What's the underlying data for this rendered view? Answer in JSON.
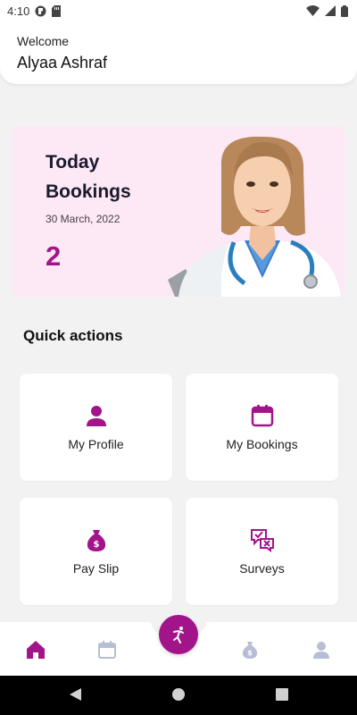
{
  "status_bar": {
    "time": "4:10",
    "icons": [
      "app-notification-icon",
      "sd-card-icon",
      "wifi-icon",
      "signal-icon",
      "battery-icon"
    ]
  },
  "header": {
    "welcome": "Welcome",
    "user_name": "Alyaa Ashraf"
  },
  "today_bookings": {
    "title": "Today Bookings",
    "date": "30 March, 2022",
    "count": "2",
    "image": "doctor-photo"
  },
  "quick_actions": {
    "title": "Quick actions",
    "items": [
      {
        "label": "My Profile",
        "icon": "person-icon"
      },
      {
        "label": "My Bookings",
        "icon": "calendar-icon"
      },
      {
        "label": "Pay Slip",
        "icon": "money-bag-icon"
      },
      {
        "label": "Surveys",
        "icon": "survey-icon"
      }
    ]
  },
  "bottom_nav": {
    "items": [
      "home-icon",
      "calendar-icon",
      "dancer-icon",
      "money-bag-icon",
      "person-icon"
    ],
    "active": "home-icon"
  },
  "colors": {
    "accent": "#a2158a",
    "card_bg": "#fde8f5",
    "inactive_nav": "#b8bdd6",
    "page_bg": "#f2f2f2"
  }
}
